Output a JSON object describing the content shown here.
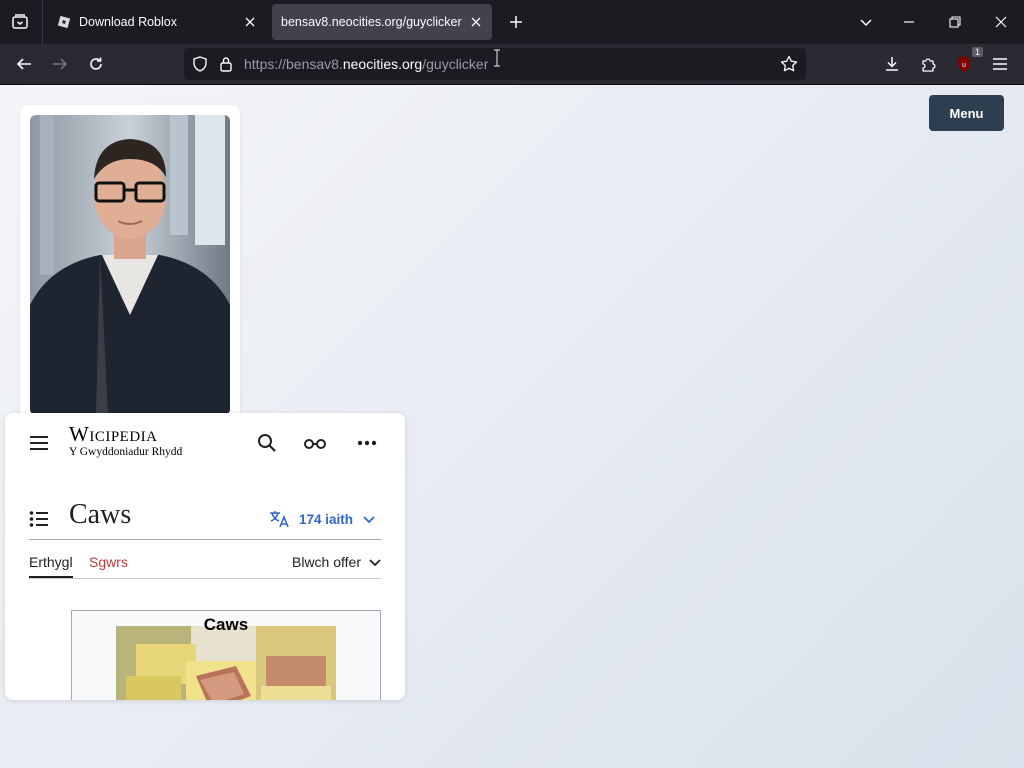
{
  "browser": {
    "tabs": [
      {
        "title": "Download Roblox",
        "active": false,
        "favicon": "roblox-icon"
      },
      {
        "title": "bensav8.neocities.org/guyclicker",
        "active": true,
        "favicon": ""
      }
    ],
    "url": {
      "prefix": "https://bensav8.",
      "host": "neocities.org",
      "path": "/guyclicker"
    },
    "extension_badge": "1",
    "icons": {
      "tab_list": "tab-list-icon",
      "new_tab": "plus-icon",
      "back": "back-arrow-icon",
      "forward": "forward-arrow-icon",
      "reload": "reload-icon",
      "tracking": "shield-icon",
      "lock": "lock-icon",
      "bookmark": "star-icon",
      "downloads": "download-icon",
      "extensions": "puzzle-icon",
      "ublock": "ublock-icon",
      "app_menu": "hamburger-icon"
    }
  },
  "page": {
    "menu_button": "Menu",
    "wiki": {
      "logo_word": "Wicipedia",
      "logo_tagline": "Y Gwyddoniadur Rhydd",
      "article_title": "Caws",
      "languages": "174 iaith",
      "tab_article": "Erthygl",
      "tab_talk": "Sgwrs",
      "tools": "Blwch offer",
      "infobox_title": "Caws"
    }
  },
  "colors": {
    "chrome_dark": "#1c1b22",
    "toolbar": "#2b2a33",
    "active_tab": "#42414d",
    "menu_button": "#2c3e50",
    "wiki_link": "#3366cc",
    "wiki_talk": "#ba3b3b"
  }
}
